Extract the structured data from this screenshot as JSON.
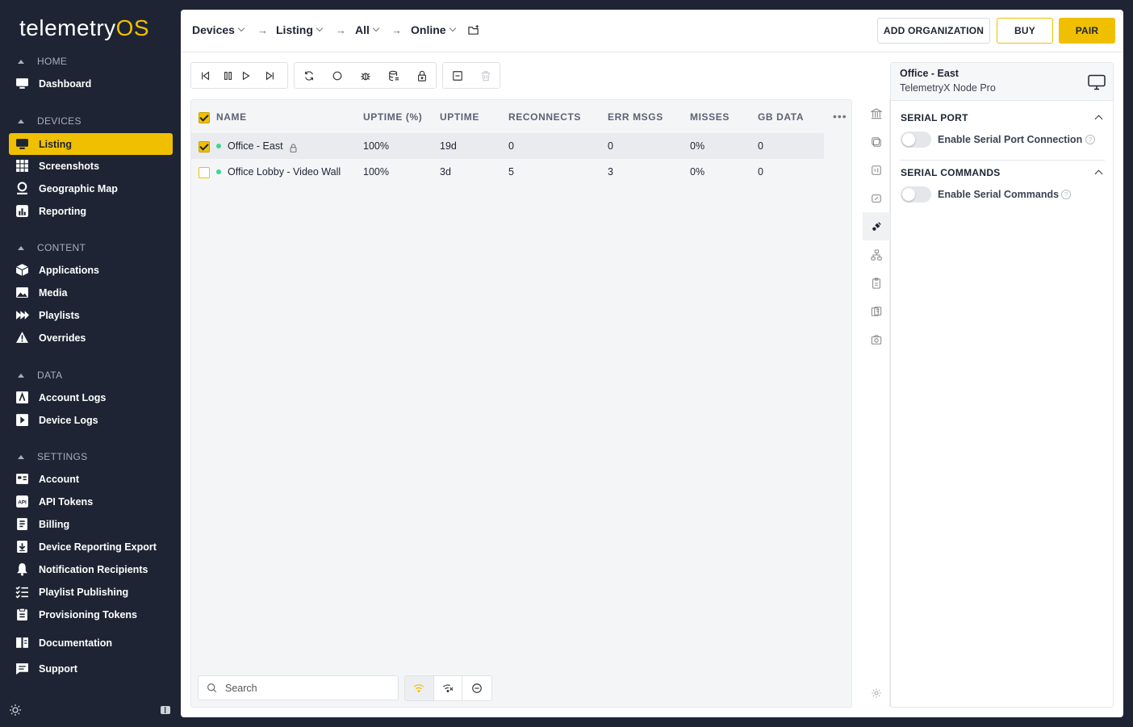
{
  "sidebar": {
    "logo_main": "telemetry",
    "logo_accent": "OS",
    "sections": {
      "home": "HOME",
      "devices": "DEVICES",
      "content": "CONTENT",
      "data": "DATA",
      "settings": "SETTINGS"
    },
    "items": {
      "dashboard": "Dashboard",
      "listing": "Listing",
      "screenshots": "Screenshots",
      "geographic_map": "Geographic Map",
      "reporting": "Reporting",
      "applications": "Applications",
      "media": "Media",
      "playlists": "Playlists",
      "overrides": "Overrides",
      "account_logs": "Account Logs",
      "device_logs": "Device Logs",
      "account": "Account",
      "api_tokens": "API Tokens",
      "billing": "Billing",
      "device_reporting_export": "Device Reporting Export",
      "notification_recipients": "Notification Recipients",
      "playlist_publishing": "Playlist Publishing",
      "provisioning_tokens": "Provisioning Tokens",
      "documentation": "Documentation",
      "support": "Support"
    }
  },
  "breadcrumb": {
    "devices": "Devices",
    "listing": "Listing",
    "all": "All",
    "online": "Online",
    "separator": "→"
  },
  "header_buttons": {
    "add_org": "ADD ORGANIZATION",
    "buy": "BUY",
    "pair": "PAIR"
  },
  "table": {
    "columns": {
      "name": "NAME",
      "uptime_pct": "UPTIME (%)",
      "uptime": "UPTIME",
      "reconnects": "RECONNECTS",
      "err_msgs": "ERR MSGS",
      "misses": "MISSES",
      "gb_data": "GB DATA"
    },
    "more": "•••",
    "rows": [
      {
        "name": "Office - East",
        "uptime_pct": "100%",
        "uptime": "19d",
        "reconnects": "0",
        "err_msgs": "0",
        "misses": "0%",
        "gb_data": "0",
        "selected": true,
        "locked": true,
        "status": "online"
      },
      {
        "name": "Office Lobby - Video Wall",
        "uptime_pct": "100%",
        "uptime": "3d",
        "reconnects": "5",
        "err_msgs": "3",
        "misses": "0%",
        "gb_data": "0",
        "selected": false,
        "locked": false,
        "status": "online"
      }
    ]
  },
  "search": {
    "placeholder": "Search"
  },
  "detail": {
    "title": "Office - East",
    "subtitle": "TelemetryX Node Pro",
    "serial_port": {
      "heading": "SERIAL PORT",
      "toggle_label": "Enable Serial Port Connection",
      "enabled": false
    },
    "serial_commands": {
      "heading": "SERIAL COMMANDS",
      "toggle_label": "Enable Serial Commands",
      "enabled": false
    }
  },
  "colors": {
    "accent": "#f0c000",
    "sidebar_bg": "#1e2433",
    "online": "#3dd68c"
  },
  "icons": {
    "status_dot": "online-dot-icon",
    "help": "?"
  }
}
